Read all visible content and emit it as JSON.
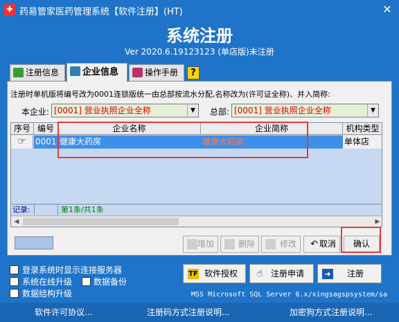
{
  "window": {
    "title": "药易管家医药管理系统【软件注册】(HT)",
    "close_glyph": "✕"
  },
  "header": {
    "title": "系统注册",
    "version": "Ver 2020.6.19123123 (单店版)未注册"
  },
  "tabs": [
    {
      "label": "注册信息",
      "icon": "register-info-icon"
    },
    {
      "label": "企业信息",
      "icon": "enterprise-icon"
    },
    {
      "label": "操作手册",
      "icon": "manual-book-icon"
    },
    {
      "label": "?",
      "icon": "help-icon"
    }
  ],
  "enterprise": {
    "hint": "注册时单机版将编号改为0001连锁版统一由总部按流水分配,名称改为(许可证全称)、并入简称:",
    "current_label": "本企业:",
    "current_value": "[0001] 营业执照企业全称",
    "hq_label": "总部:",
    "hq_value": "[0001] 营业执照企业全称"
  },
  "grid": {
    "columns": [
      "序号",
      "编号",
      "企业名称",
      "企业简称",
      "机构类型"
    ],
    "rows": [
      {
        "pointer": "☞",
        "code": "0001",
        "name": "健康大药房",
        "short": "健康大药房",
        "type": "单体店"
      }
    ],
    "footer_label": "记录:",
    "footer_count": "第1条/共1条"
  },
  "actions": {
    "add": "增加",
    "delete": "删除",
    "edit": "修改",
    "cancel": "取消",
    "confirm": "确认"
  },
  "options": {
    "show_server": "登录系统时显示连接服务器",
    "online_upgrade": "系统在线升级",
    "data_backup": "数据备份",
    "db_upgrade": "数据结构升级"
  },
  "buttons": {
    "license": "软件授权",
    "apply": "注册申请",
    "register": "注册"
  },
  "db_info": "MSS Microsoft SQL Server 6.x/xingsagspsystem/sa",
  "links": {
    "agreement": "软件许可协议...",
    "code_help": "注册码方式注册说明...",
    "dongle_help": "加密狗方式注册说明..."
  },
  "colors": {
    "window_bg": "#1f74c9",
    "selected_row": "#3d8fea",
    "red_highlight": "#e53a3a",
    "combo_text": "#d80000"
  }
}
